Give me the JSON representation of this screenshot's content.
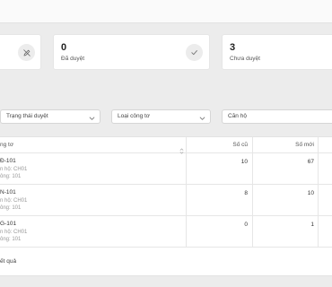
{
  "stats": [
    {
      "value": "",
      "label": "",
      "icon": "pen-off-icon"
    },
    {
      "value": "0",
      "label": "Đã duyệt",
      "icon": "check-icon"
    },
    {
      "value": "3",
      "label": "Chưa duyệt",
      "icon": ""
    }
  ],
  "filters": {
    "status_label": "Trạng thái duyệt",
    "meter_type_label": "Loại công tơ",
    "apartment_label": "Căn hộ"
  },
  "table": {
    "columns": {
      "meter": "ng tơ",
      "old_reading": "Số cũ",
      "new_reading": "Số mới"
    },
    "rows": [
      {
        "code": "Đ-101",
        "apartment": "n hộ: CH01",
        "meter": "ông: 101",
        "old": "10",
        "new": "67"
      },
      {
        "code": "N-101",
        "apartment": "n hộ: CH01",
        "meter": "ông: 101",
        "old": "8",
        "new": "10"
      },
      {
        "code": "G-101",
        "apartment": "n hộ: CH01",
        "meter": "ông: 101",
        "old": "0",
        "new": "1"
      }
    ],
    "footer": "ết quả"
  }
}
